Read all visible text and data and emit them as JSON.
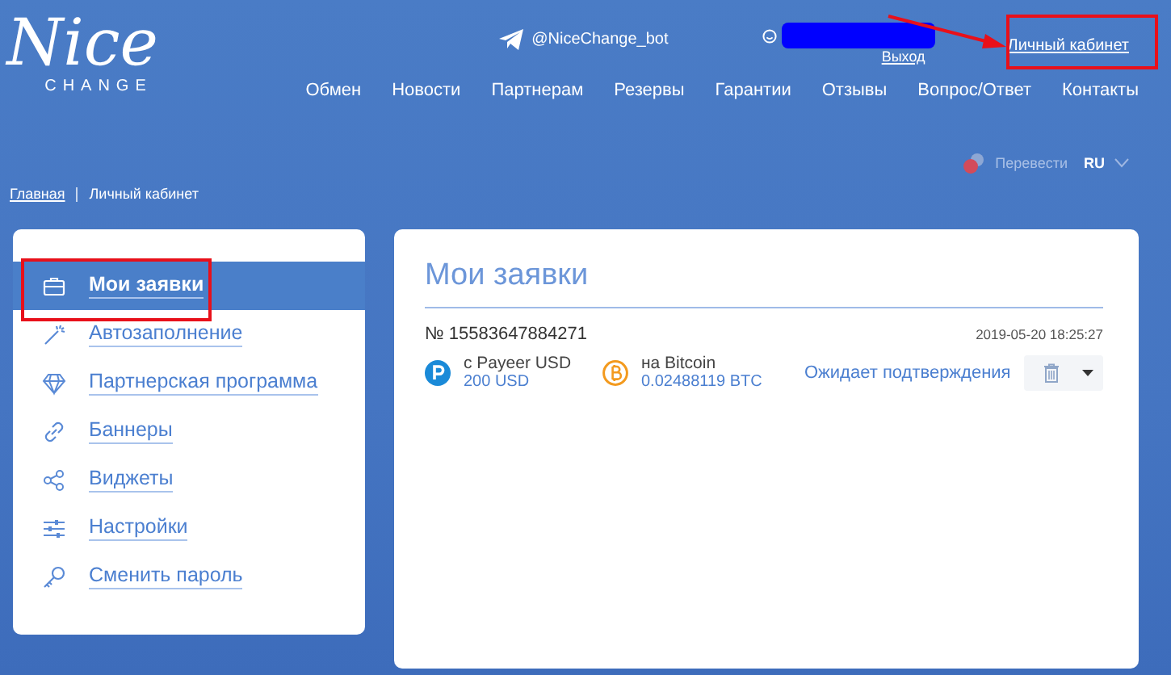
{
  "header": {
    "logo": {
      "title": "Nice",
      "subtitle": "CHANGE"
    },
    "telegram": "@NiceChange_bot",
    "user": {
      "logout": "Выход"
    },
    "account_link": "Личный кабинет",
    "nav": [
      "Обмен",
      "Новости",
      "Партнерам",
      "Резервы",
      "Гарантии",
      "Отзывы",
      "Вопрос/Ответ",
      "Контакты"
    ]
  },
  "language": {
    "translate": "Перевести",
    "current": "RU"
  },
  "breadcrumb": [
    {
      "label": "Главная",
      "link": true
    },
    {
      "label": "Личный кабинет",
      "link": false
    }
  ],
  "sidebar": {
    "items": [
      {
        "label": "Мои заявки",
        "selected": true
      },
      {
        "label": "Автозаполнение",
        "selected": false
      },
      {
        "label": "Партнерская программа",
        "selected": false
      },
      {
        "label": "Баннеры",
        "selected": false
      },
      {
        "label": "Виджеты",
        "selected": false
      },
      {
        "label": "Настройки",
        "selected": false
      },
      {
        "label": "Сменить пароль",
        "selected": false
      }
    ]
  },
  "main": {
    "title": "Мои заявки",
    "orders": [
      {
        "number": "№ 15583647884271",
        "date": "2019-05-20 18:25:27",
        "from": {
          "label": "с Payeer USD",
          "amount": "200 USD"
        },
        "to": {
          "label": "на Bitcoin",
          "amount": "0.02488119 BTC"
        },
        "status": "Ожидает подтверждения"
      }
    ]
  }
}
